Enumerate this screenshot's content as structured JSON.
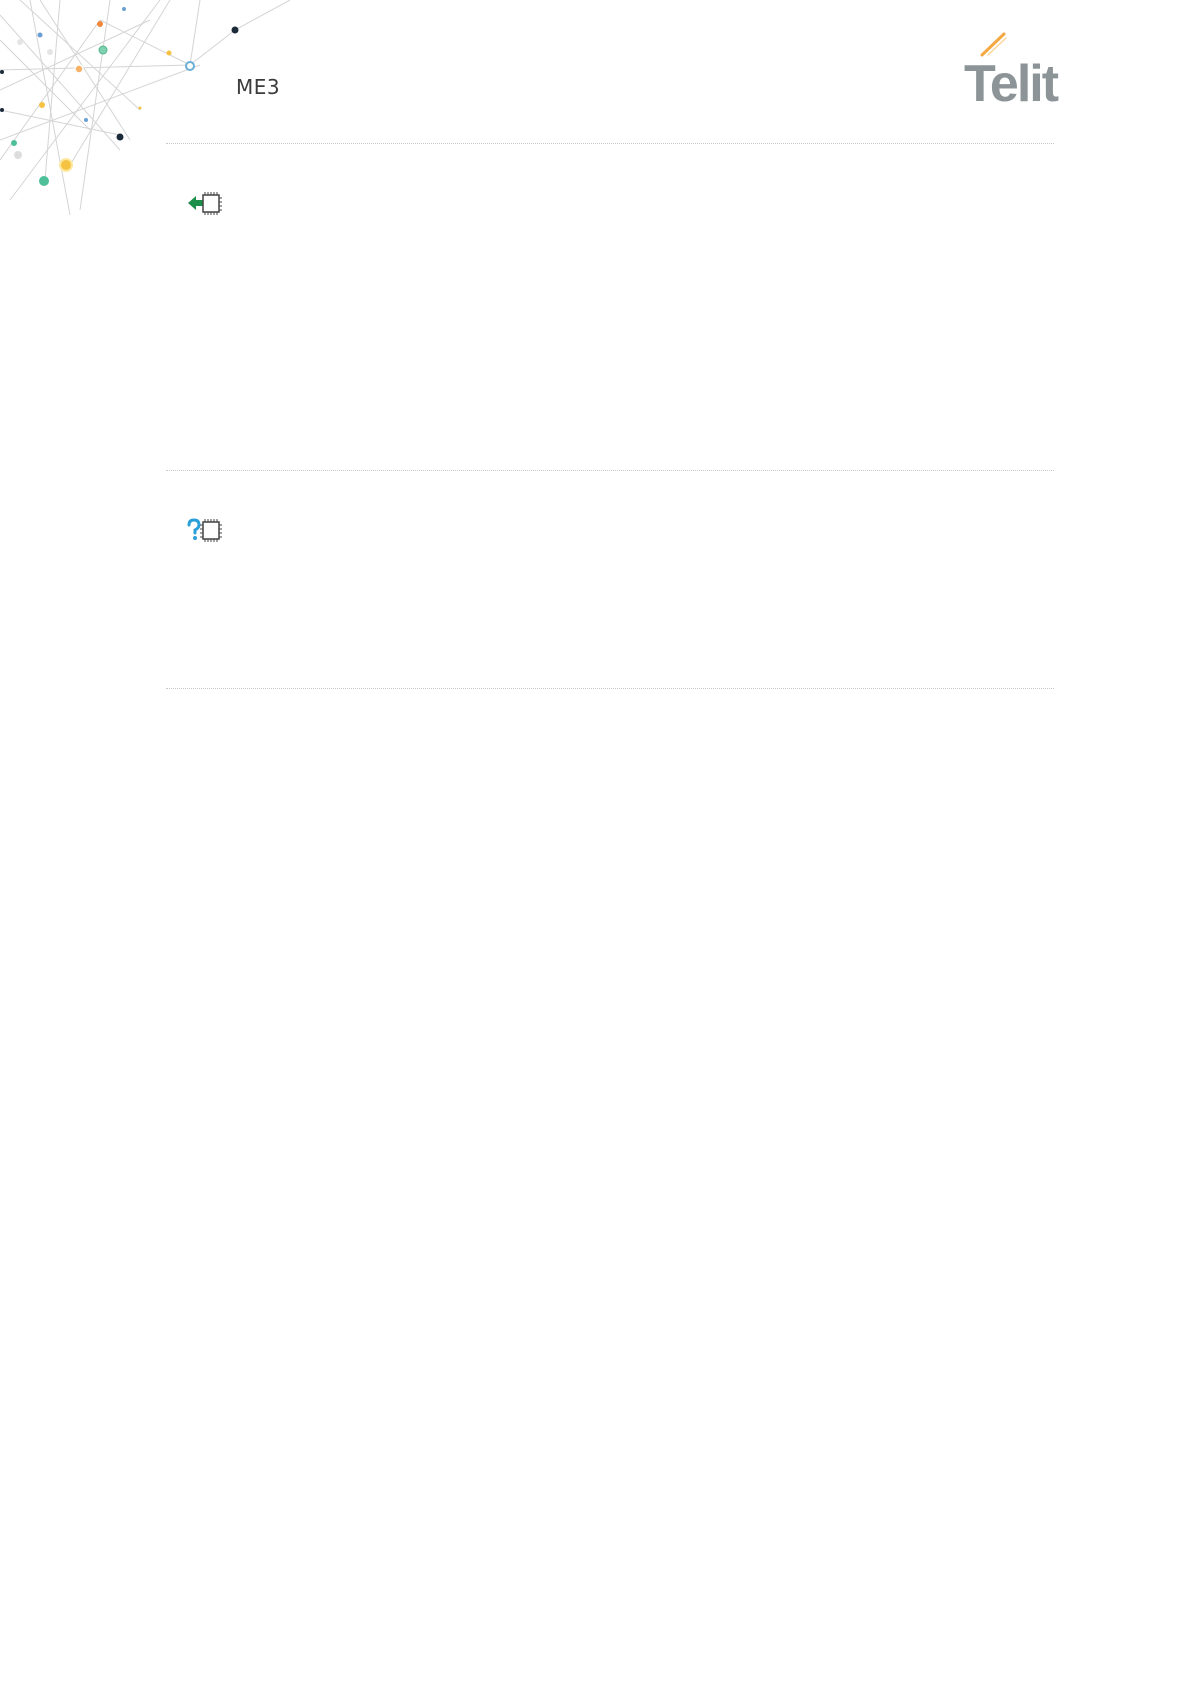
{
  "header": {
    "title": "ME3",
    "logo_text": "Telit"
  },
  "sections": [
    {
      "icon": "set-command-icon"
    },
    {
      "icon": "read-command-icon"
    }
  ],
  "colors": {
    "logo_gray": "#8c9497",
    "logo_accent": "#f5a742",
    "set_arrow": "#1a8f4a",
    "read_question": "#2b9fd8",
    "divider": "#c8c8c8"
  }
}
